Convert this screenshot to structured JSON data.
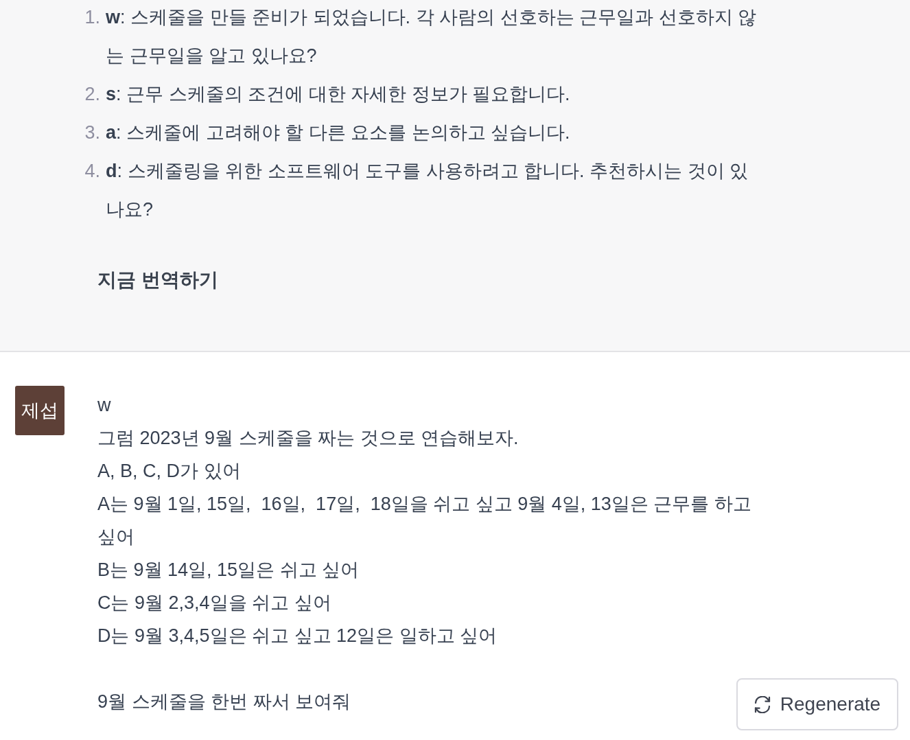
{
  "assistant_message": {
    "items": [
      {
        "marker": "1.",
        "text": "**w**: 스케줄을 만들 준비가 되었습니다. 각 사람의 선호하는 근무일과 선호하지 않는 근무일을 알고 있나요?"
      },
      {
        "marker": "2.",
        "text": "**s**: 근무 스케줄의 조건에 대한 자세한 정보가 필요합니다."
      },
      {
        "marker": "3.",
        "text": "**a**: 스케줄에 고려해야 할 다른 요소를 논의하고 싶습니다."
      },
      {
        "marker": "4.",
        "text": "**d**: 스케줄링을 위한 소프트웨어 도구를 사용하려고 합니다. 추천하시는 것이 있나요?"
      }
    ],
    "footer": "지금 번역하기"
  },
  "user_message": {
    "avatar": "제섭",
    "name": "w",
    "paragraphs": [
      [
        "그럼 2023년 9월 스케줄을 짜는 것으로 연습해보자.",
        "A, B, C, D가 있어",
        "A는 9월 1일, 15일,  16일,  17일,  18일을 쉬고 싶고 9월 4일, 13일은 근무를 하고 싶어",
        "B는 9월 14일, 15일은 쉬고 싶어",
        "C는 9월 2,3,4일을 쉬고 싶어",
        "D는 9월 3,4,5일은 쉬고 싶고 12일은 일하고 싶어"
      ],
      [
        "9월 스케줄을 한번 짜서 보여줘"
      ]
    ]
  },
  "regenerate_button": {
    "label": "Regenerate"
  }
}
